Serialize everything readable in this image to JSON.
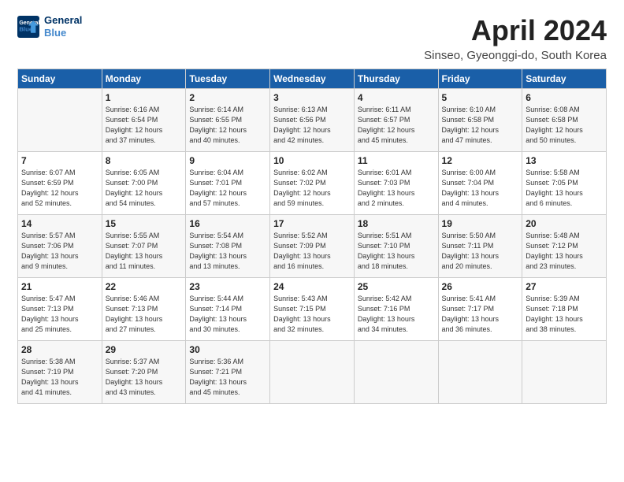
{
  "logo": {
    "line1": "General",
    "line2": "Blue"
  },
  "title": "April 2024",
  "location": "Sinseo, Gyeonggi-do, South Korea",
  "days_header": [
    "Sunday",
    "Monday",
    "Tuesday",
    "Wednesday",
    "Thursday",
    "Friday",
    "Saturday"
  ],
  "weeks": [
    [
      {
        "day": "",
        "content": ""
      },
      {
        "day": "1",
        "content": "Sunrise: 6:16 AM\nSunset: 6:54 PM\nDaylight: 12 hours\nand 37 minutes."
      },
      {
        "day": "2",
        "content": "Sunrise: 6:14 AM\nSunset: 6:55 PM\nDaylight: 12 hours\nand 40 minutes."
      },
      {
        "day": "3",
        "content": "Sunrise: 6:13 AM\nSunset: 6:56 PM\nDaylight: 12 hours\nand 42 minutes."
      },
      {
        "day": "4",
        "content": "Sunrise: 6:11 AM\nSunset: 6:57 PM\nDaylight: 12 hours\nand 45 minutes."
      },
      {
        "day": "5",
        "content": "Sunrise: 6:10 AM\nSunset: 6:58 PM\nDaylight: 12 hours\nand 47 minutes."
      },
      {
        "day": "6",
        "content": "Sunrise: 6:08 AM\nSunset: 6:58 PM\nDaylight: 12 hours\nand 50 minutes."
      }
    ],
    [
      {
        "day": "7",
        "content": "Sunrise: 6:07 AM\nSunset: 6:59 PM\nDaylight: 12 hours\nand 52 minutes."
      },
      {
        "day": "8",
        "content": "Sunrise: 6:05 AM\nSunset: 7:00 PM\nDaylight: 12 hours\nand 54 minutes."
      },
      {
        "day": "9",
        "content": "Sunrise: 6:04 AM\nSunset: 7:01 PM\nDaylight: 12 hours\nand 57 minutes."
      },
      {
        "day": "10",
        "content": "Sunrise: 6:02 AM\nSunset: 7:02 PM\nDaylight: 12 hours\nand 59 minutes."
      },
      {
        "day": "11",
        "content": "Sunrise: 6:01 AM\nSunset: 7:03 PM\nDaylight: 13 hours\nand 2 minutes."
      },
      {
        "day": "12",
        "content": "Sunrise: 6:00 AM\nSunset: 7:04 PM\nDaylight: 13 hours\nand 4 minutes."
      },
      {
        "day": "13",
        "content": "Sunrise: 5:58 AM\nSunset: 7:05 PM\nDaylight: 13 hours\nand 6 minutes."
      }
    ],
    [
      {
        "day": "14",
        "content": "Sunrise: 5:57 AM\nSunset: 7:06 PM\nDaylight: 13 hours\nand 9 minutes."
      },
      {
        "day": "15",
        "content": "Sunrise: 5:55 AM\nSunset: 7:07 PM\nDaylight: 13 hours\nand 11 minutes."
      },
      {
        "day": "16",
        "content": "Sunrise: 5:54 AM\nSunset: 7:08 PM\nDaylight: 13 hours\nand 13 minutes."
      },
      {
        "day": "17",
        "content": "Sunrise: 5:52 AM\nSunset: 7:09 PM\nDaylight: 13 hours\nand 16 minutes."
      },
      {
        "day": "18",
        "content": "Sunrise: 5:51 AM\nSunset: 7:10 PM\nDaylight: 13 hours\nand 18 minutes."
      },
      {
        "day": "19",
        "content": "Sunrise: 5:50 AM\nSunset: 7:11 PM\nDaylight: 13 hours\nand 20 minutes."
      },
      {
        "day": "20",
        "content": "Sunrise: 5:48 AM\nSunset: 7:12 PM\nDaylight: 13 hours\nand 23 minutes."
      }
    ],
    [
      {
        "day": "21",
        "content": "Sunrise: 5:47 AM\nSunset: 7:13 PM\nDaylight: 13 hours\nand 25 minutes."
      },
      {
        "day": "22",
        "content": "Sunrise: 5:46 AM\nSunset: 7:13 PM\nDaylight: 13 hours\nand 27 minutes."
      },
      {
        "day": "23",
        "content": "Sunrise: 5:44 AM\nSunset: 7:14 PM\nDaylight: 13 hours\nand 30 minutes."
      },
      {
        "day": "24",
        "content": "Sunrise: 5:43 AM\nSunset: 7:15 PM\nDaylight: 13 hours\nand 32 minutes."
      },
      {
        "day": "25",
        "content": "Sunrise: 5:42 AM\nSunset: 7:16 PM\nDaylight: 13 hours\nand 34 minutes."
      },
      {
        "day": "26",
        "content": "Sunrise: 5:41 AM\nSunset: 7:17 PM\nDaylight: 13 hours\nand 36 minutes."
      },
      {
        "day": "27",
        "content": "Sunrise: 5:39 AM\nSunset: 7:18 PM\nDaylight: 13 hours\nand 38 minutes."
      }
    ],
    [
      {
        "day": "28",
        "content": "Sunrise: 5:38 AM\nSunset: 7:19 PM\nDaylight: 13 hours\nand 41 minutes."
      },
      {
        "day": "29",
        "content": "Sunrise: 5:37 AM\nSunset: 7:20 PM\nDaylight: 13 hours\nand 43 minutes."
      },
      {
        "day": "30",
        "content": "Sunrise: 5:36 AM\nSunset: 7:21 PM\nDaylight: 13 hours\nand 45 minutes."
      },
      {
        "day": "",
        "content": ""
      },
      {
        "day": "",
        "content": ""
      },
      {
        "day": "",
        "content": ""
      },
      {
        "day": "",
        "content": ""
      }
    ]
  ]
}
